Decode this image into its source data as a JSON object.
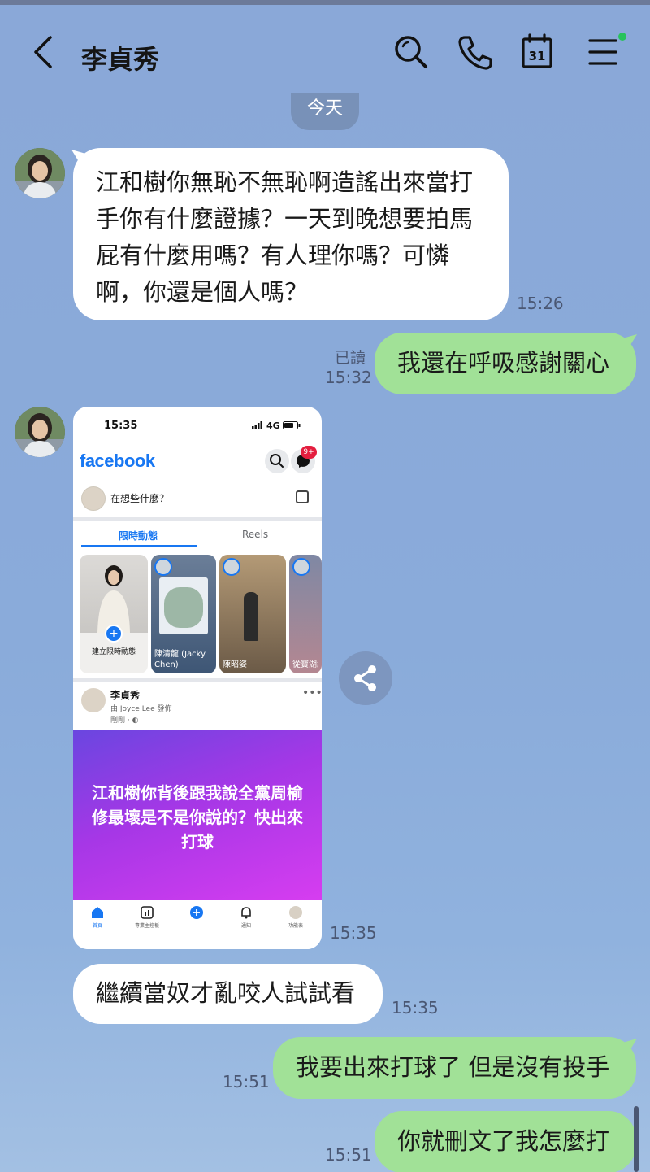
{
  "header": {
    "contact_name": "李貞秀",
    "icons": [
      "back-chevron-icon",
      "search-icon",
      "phone-icon",
      "calendar-icon",
      "menu-icon"
    ],
    "calendar_day": "31",
    "online_dot_color": "#27c25b"
  },
  "date_separator": "今天",
  "messages": [
    {
      "side": "incoming",
      "lines": [
        "江和樹你無恥不無恥啊造謠出來當打",
        "手你有什麼證據？一天到晚想要拍馬",
        "屁有什麼用嗎？有人理你嗎？可憐",
        "啊，你還是個人嗎？"
      ],
      "time": "15:26"
    },
    {
      "side": "outgoing",
      "text": "我還在呼吸感謝關心",
      "read": "已讀",
      "time": "15:32"
    },
    {
      "side": "incoming",
      "type": "image",
      "time": "15:35"
    },
    {
      "side": "incoming",
      "text": "繼續當奴才亂咬人試試看",
      "time": "15:35"
    },
    {
      "side": "outgoing",
      "text": "我要出來打球了 但是沒有投手",
      "time": "15:51"
    },
    {
      "side": "outgoing",
      "text": "你就刪文了我怎麼打",
      "time": "15:51"
    }
  ],
  "screenshot": {
    "status_time": "15:35",
    "signal_text": "4G",
    "logo": "facebook",
    "notification_badge": "9+",
    "compose_placeholder": "在想些什麼？",
    "tabs": [
      {
        "label": "限時動態",
        "active": true
      },
      {
        "label": "Reels",
        "active": false
      }
    ],
    "stories": [
      {
        "label": "建立限時動態"
      },
      {
        "label": "陳清龍 (Jacky Chen)"
      },
      {
        "label": "陳昭姿"
      },
      {
        "label": "從寶湖綠"
      }
    ],
    "post": {
      "author": "李貞秀",
      "meta": "由 Joyce Lee 發佈",
      "meta2": "剛剛 · ◐",
      "text": "江和樹你背後跟我說全黨周榆修最壞是不是你說的？快出來打球"
    },
    "nav": [
      "首頁",
      "專業主控板",
      "",
      "通知",
      "功能表"
    ],
    "brand_color": "#1877f2"
  },
  "colors": {
    "background": "#8aabda",
    "incoming_bubble": "#ffffff",
    "outgoing_bubble": "#a1e197",
    "meta_text": "#4a5773"
  }
}
